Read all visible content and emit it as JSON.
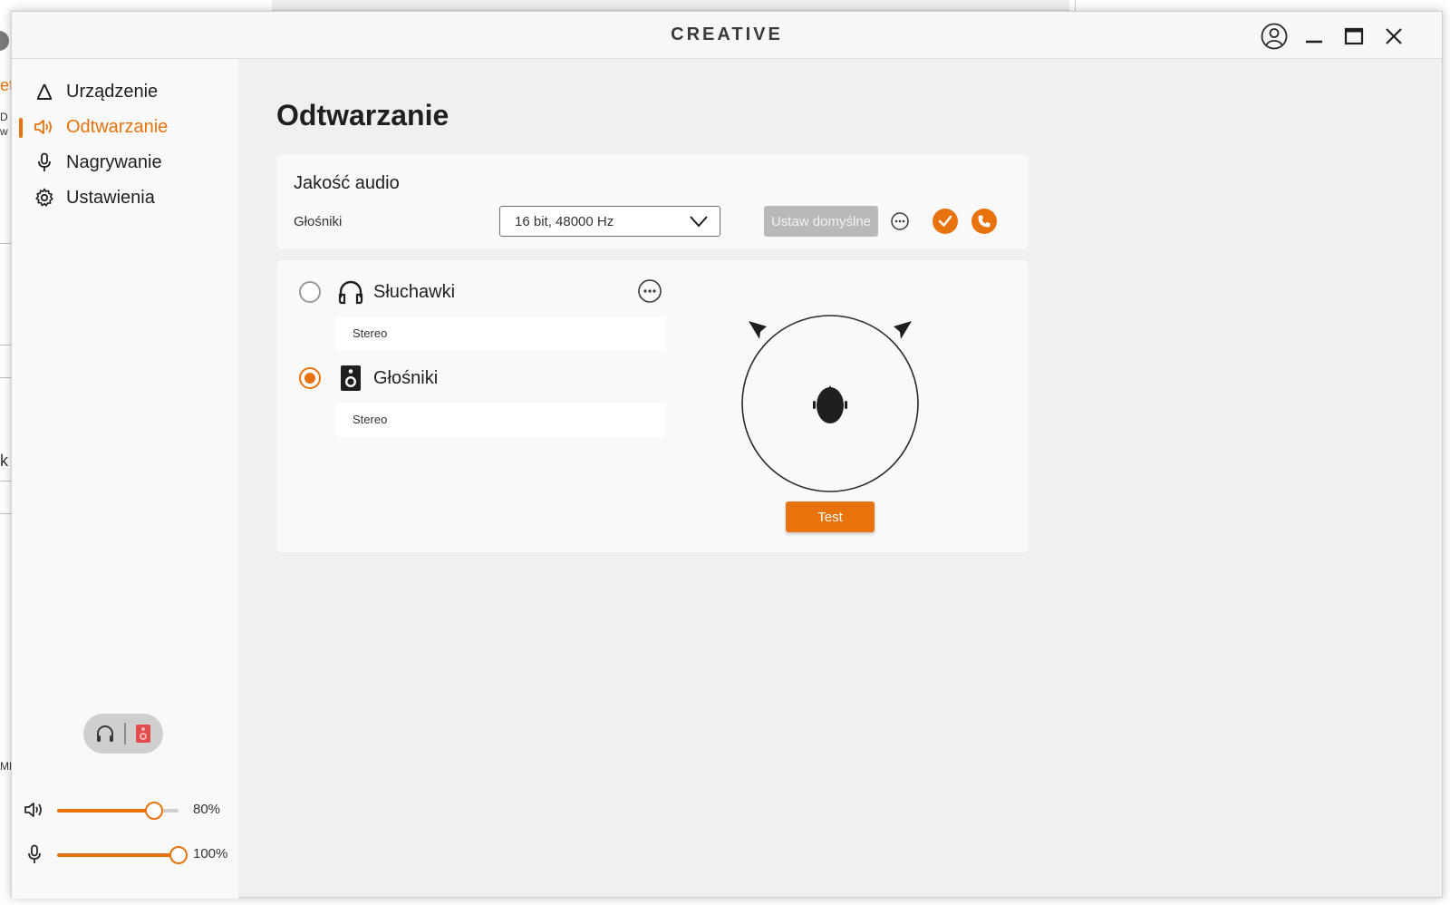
{
  "window": {
    "brand": "CREATIVE"
  },
  "background": {
    "frag_a": "et",
    "frag_b": "D s",
    "frag_c": "w",
    "frag_d": "k",
    "frag_e": "MB"
  },
  "sidebar": {
    "items": [
      {
        "label": "Urządzenie",
        "icon": "device-icon"
      },
      {
        "label": "Odtwarzanie",
        "icon": "speaker-volume-icon",
        "active": true
      },
      {
        "label": "Nagrywanie",
        "icon": "microphone-icon"
      },
      {
        "label": "Ustawienia",
        "icon": "gear-icon"
      }
    ],
    "volume": {
      "value_label": "80%",
      "level": 0.8
    },
    "mic": {
      "value_label": "100%",
      "level": 1.0
    }
  },
  "page": {
    "title": "Odtwarzanie"
  },
  "audio_quality": {
    "title": "Jakość audio",
    "device_label": "Głośniki",
    "format_value": "16 bit, 48000 Hz",
    "set_default_label": "Ustaw domyślne"
  },
  "outputs": [
    {
      "name": "Słuchawki",
      "mode": "Stereo",
      "selected": false,
      "icon": "headphones-icon"
    },
    {
      "name": "Głośniki",
      "mode": "Stereo",
      "selected": true,
      "icon": "speaker-icon"
    }
  ],
  "test": {
    "label": "Test"
  },
  "colors": {
    "accent": "#e8720c",
    "sidebar_bg": "#f9f9f9",
    "content_bg": "#f0f0f0"
  }
}
